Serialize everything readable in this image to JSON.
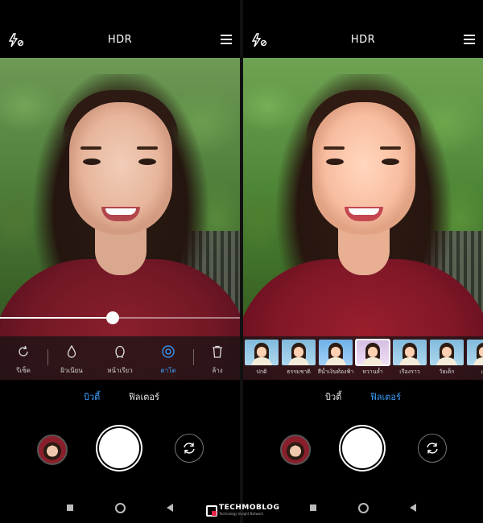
{
  "top_bar": {
    "hdr_label": "HDR",
    "flash_icon": "flash-off-icon",
    "menu_icon": "menu-icon"
  },
  "left_panel": {
    "slider_value": 0.47,
    "beauty_options": [
      {
        "label": "รีเซ็ต",
        "icon": "reset-icon"
      },
      {
        "label": "ผิวเนียน",
        "icon": "drop-icon"
      },
      {
        "label": "หน้าเรียว",
        "icon": "face-slim-icon"
      },
      {
        "label": "ตาโต",
        "icon": "eye-enlarge-icon",
        "active": true
      }
    ],
    "clear_label": "ล้าง",
    "modes": [
      {
        "label": "บิวตี้",
        "active": true
      },
      {
        "label": "ฟิลเตอร์",
        "active": false
      }
    ]
  },
  "right_panel": {
    "filters": [
      {
        "label": "ปกติ"
      },
      {
        "label": "ธรรมชาติ"
      },
      {
        "label": "สีน้ำเงินท้องฟ้า"
      },
      {
        "label": "หวานล้ำ",
        "selected": true
      },
      {
        "label": "เรืองราว"
      },
      {
        "label": "วัยเด็ก"
      },
      {
        "label": "เซ"
      }
    ],
    "modes": [
      {
        "label": "บิวตี้",
        "active": false
      },
      {
        "label": "ฟิลเตอร์",
        "active": true
      }
    ]
  },
  "watermark": {
    "brand": "TECHMOBLOG",
    "tagline": "Technology Insight Network"
  },
  "colors": {
    "accent": "#3aa0ff",
    "background": "#000000"
  }
}
